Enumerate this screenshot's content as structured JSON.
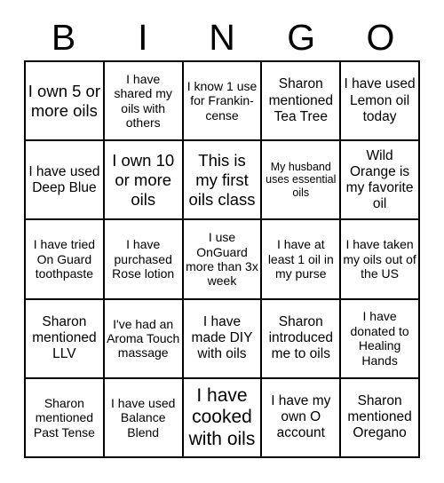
{
  "card": {
    "title_letters": [
      {
        "label": "B"
      },
      {
        "label": "I"
      },
      {
        "label": "N"
      },
      {
        "label": "G"
      },
      {
        "label": "O"
      }
    ],
    "colors": {
      "background": "#ffffff",
      "text": "#000000",
      "grid_line": "#000000"
    },
    "rows": [
      {
        "cells": [
          {
            "text": "I own 5 or more oils",
            "size": "l"
          },
          {
            "text": "I have shared my oils with others",
            "size": "s"
          },
          {
            "text": "I know 1 use for Frankin-cense",
            "size": "s"
          },
          {
            "text": "Sharon mentioned Tea Tree",
            "size": "m"
          },
          {
            "text": "I have used Lemon oil today",
            "size": "m"
          }
        ]
      },
      {
        "cells": [
          {
            "text": "I have used Deep Blue",
            "size": "m"
          },
          {
            "text": "I own 10 or more oils",
            "size": "l"
          },
          {
            "text": "This is my first oils class",
            "size": "l"
          },
          {
            "text": "My husband uses essential oils",
            "size": "xs"
          },
          {
            "text": "Wild Orange is my favorite oil",
            "size": "m"
          }
        ]
      },
      {
        "cells": [
          {
            "text": "I have tried On Guard toothpaste",
            "size": "s"
          },
          {
            "text": "I have purchased Rose lotion",
            "size": "s"
          },
          {
            "text": "I use OnGuard more than 3x week",
            "size": "s"
          },
          {
            "text": "I have at least 1 oil in my purse",
            "size": "s"
          },
          {
            "text": "I have taken my oils out of the US",
            "size": "s"
          }
        ]
      },
      {
        "cells": [
          {
            "text": "Sharon mentioned LLV",
            "size": "m"
          },
          {
            "text": "I've had an Aroma Touch massage",
            "size": "s"
          },
          {
            "text": "I have made DIY with oils",
            "size": "m"
          },
          {
            "text": "Sharon introduced me to oils",
            "size": "m"
          },
          {
            "text": "I have donated to Healing Hands",
            "size": "s"
          }
        ]
      },
      {
        "cells": [
          {
            "text": "Sharon mentioned Past Tense",
            "size": "s"
          },
          {
            "text": "I have used Balance Blend",
            "size": "s"
          },
          {
            "text": "I have cooked with oils",
            "size": "xl"
          },
          {
            "text": "I have my own O account",
            "size": "m"
          },
          {
            "text": "Sharon mentioned Oregano",
            "size": "m"
          }
        ]
      }
    ]
  }
}
